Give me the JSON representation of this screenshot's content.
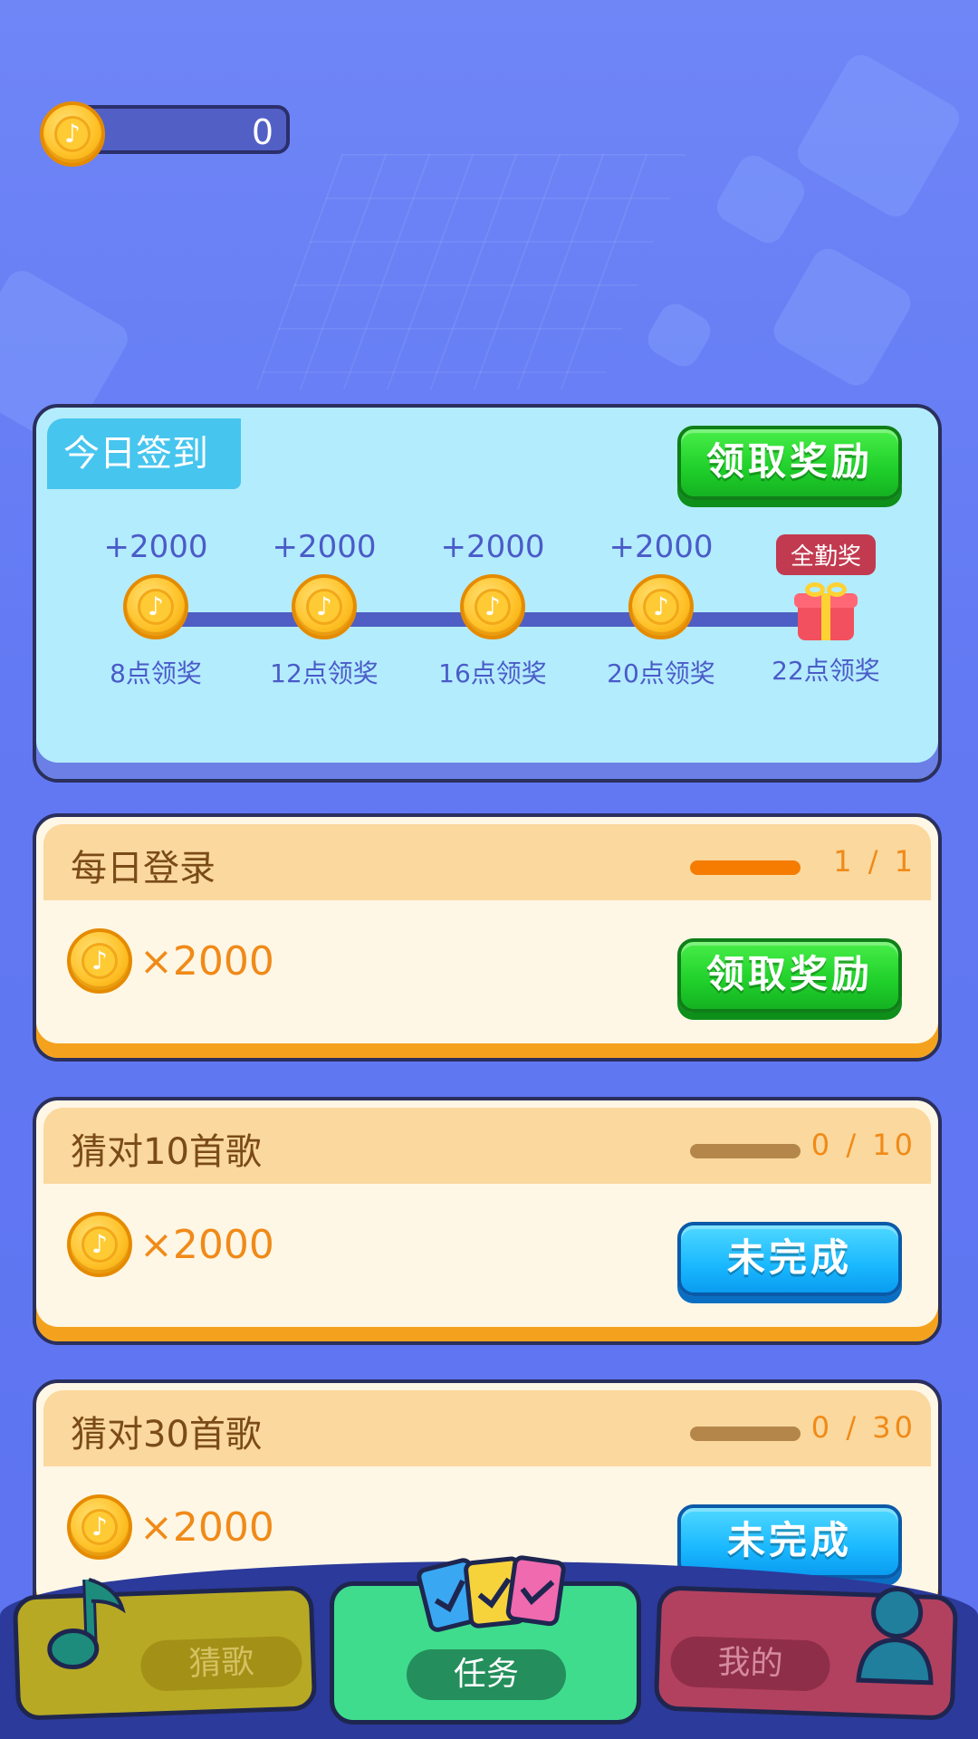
{
  "balance": {
    "coins": "0",
    "icon": "coin-icon"
  },
  "signin": {
    "title": "今日签到",
    "claim_label": "领取奖励",
    "steps": [
      {
        "amount": "+2000",
        "time": "8点领奖"
      },
      {
        "amount": "+2000",
        "time": "12点领奖"
      },
      {
        "amount": "+2000",
        "time": "16点领奖"
      },
      {
        "amount": "+2000",
        "time": "20点领奖"
      },
      {
        "badge": "全勤奖",
        "time": "22点领奖",
        "icon": "gift-icon"
      }
    ]
  },
  "tasks": [
    {
      "title": "每日登录",
      "progress": "1 / 1",
      "progress_fraction": 1,
      "reward": "×2000",
      "button": "领取奖励",
      "button_state": "claim"
    },
    {
      "title": "猜对10首歌",
      "progress": "0 / 10",
      "progress_fraction": 0,
      "reward": "×2000",
      "button": "未完成",
      "button_state": "incomplete"
    },
    {
      "title": "猜对30首歌",
      "progress": "0 / 30",
      "progress_fraction": 0,
      "reward": "×2000",
      "button": "未完成",
      "button_state": "incomplete"
    }
  ],
  "nav": [
    {
      "label": "猜歌",
      "icon": "music-note-icon",
      "active": false
    },
    {
      "label": "任务",
      "icon": "clipboard-icon",
      "active": true
    },
    {
      "label": "我的",
      "icon": "person-icon",
      "active": false
    }
  ],
  "colors": {
    "background": "#6279f3",
    "signin_card": "#b3ecfd",
    "task_card": "#fff7e6",
    "progress_done": "#f57c00",
    "progress_empty": "#b5864a",
    "green_button": "#1fcf2a",
    "blue_button": "#1ab8ff"
  }
}
